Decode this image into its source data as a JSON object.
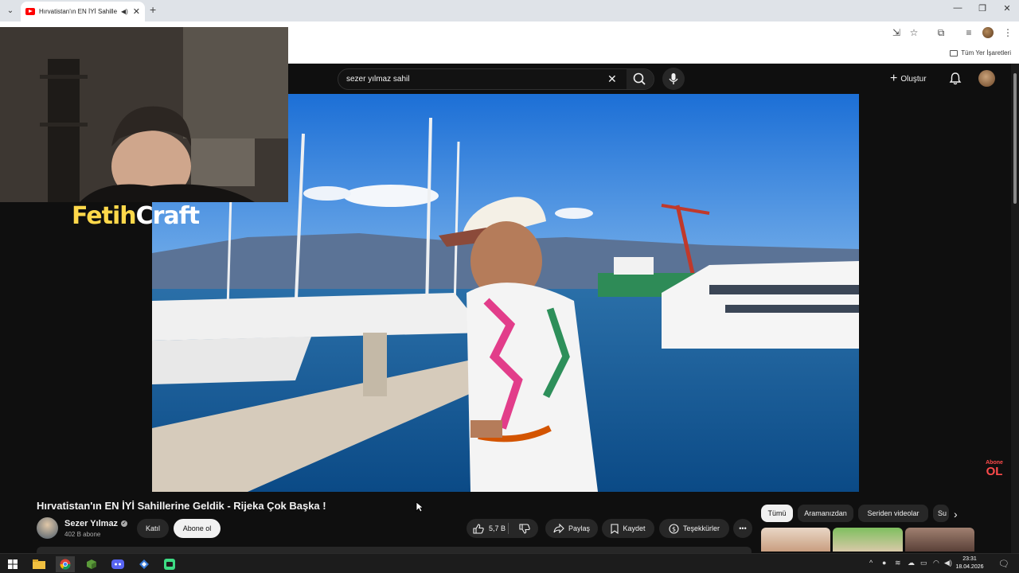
{
  "browser": {
    "tab_title": "Hırvatistan'ın EN İYİ Sahiller",
    "bookmarks_all": "Tüm Yer İşaretleri"
  },
  "youtube": {
    "search": {
      "value": "sezer yılmaz sahil"
    },
    "create_label": "Oluştur"
  },
  "overlay": {
    "logo_part1": "Fetih",
    "logo_part2": "Craft",
    "watermark_line1": "Abone",
    "watermark_line2": "OL"
  },
  "video": {
    "title": "Hırvatistan'ın EN İYİ Sahillerine Geldik - Rijeka Çok Başka !",
    "channel": {
      "name": "Sezer Yılmaz",
      "subscribers": "402 B abone"
    },
    "buttons": {
      "join": "Katıl",
      "subscribe": "Abone ol",
      "likes": "5,7 B",
      "share": "Paylaş",
      "save": "Kaydet",
      "thanks": "Teşekkürler"
    }
  },
  "chips": [
    "Tümü",
    "Aramanızdan",
    "Seriden videolar",
    "Su"
  ],
  "taskbar": {
    "time": "23:31",
    "date": "18.04.2026"
  },
  "colors": {
    "youtube_red": "#ff0000",
    "background": "#0f0f0f",
    "button_dark": "#272727"
  }
}
